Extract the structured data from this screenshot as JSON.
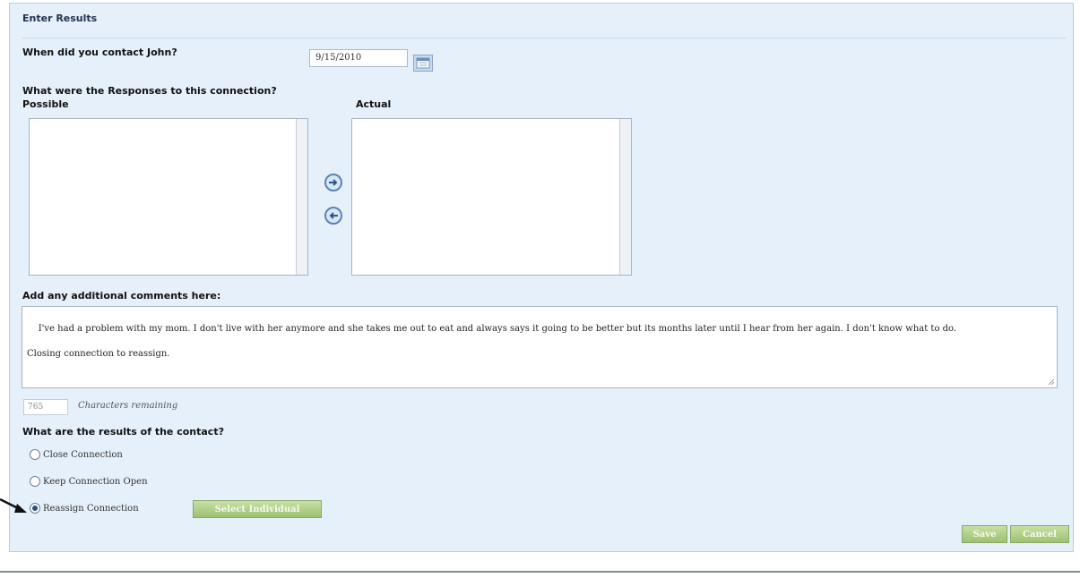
{
  "panel": {
    "title": "Enter Results"
  },
  "contact": {
    "question": "When did you contact John?",
    "date_value": "9/15/2010",
    "calendar_icon": "calendar-icon"
  },
  "responses": {
    "question": "What were the Responses to this connection?",
    "possible_label": "Possible",
    "actual_label": "Actual",
    "possible_items": [],
    "actual_items": [],
    "move_right_icon": "arrow-right-circle-icon",
    "move_left_icon": "arrow-left-circle-icon"
  },
  "comments": {
    "label": "Add any additional comments here:",
    "value": "I've had a problem with my mom. I don't live with her anymore and she takes me out to eat and always says it going to be better but its months later until I hear from her again. I don't know what to do.\n\nClosing connection to reassign.",
    "chars_remaining_value": "765",
    "chars_remaining_label": "Characters remaining"
  },
  "results": {
    "question": "What are the results of the contact?",
    "options": [
      {
        "label": "Close Connection",
        "checked": false
      },
      {
        "label": "Keep Connection Open",
        "checked": false
      },
      {
        "label": "Reassign Connection",
        "checked": true
      }
    ],
    "select_individual_label": "Select Individual"
  },
  "actions": {
    "save_label": "Save",
    "cancel_label": "Cancel"
  },
  "colors": {
    "panel_bg": "#e6f0fb",
    "accent_green": "#9fc172",
    "radio_fill": "#2b4d7e"
  }
}
